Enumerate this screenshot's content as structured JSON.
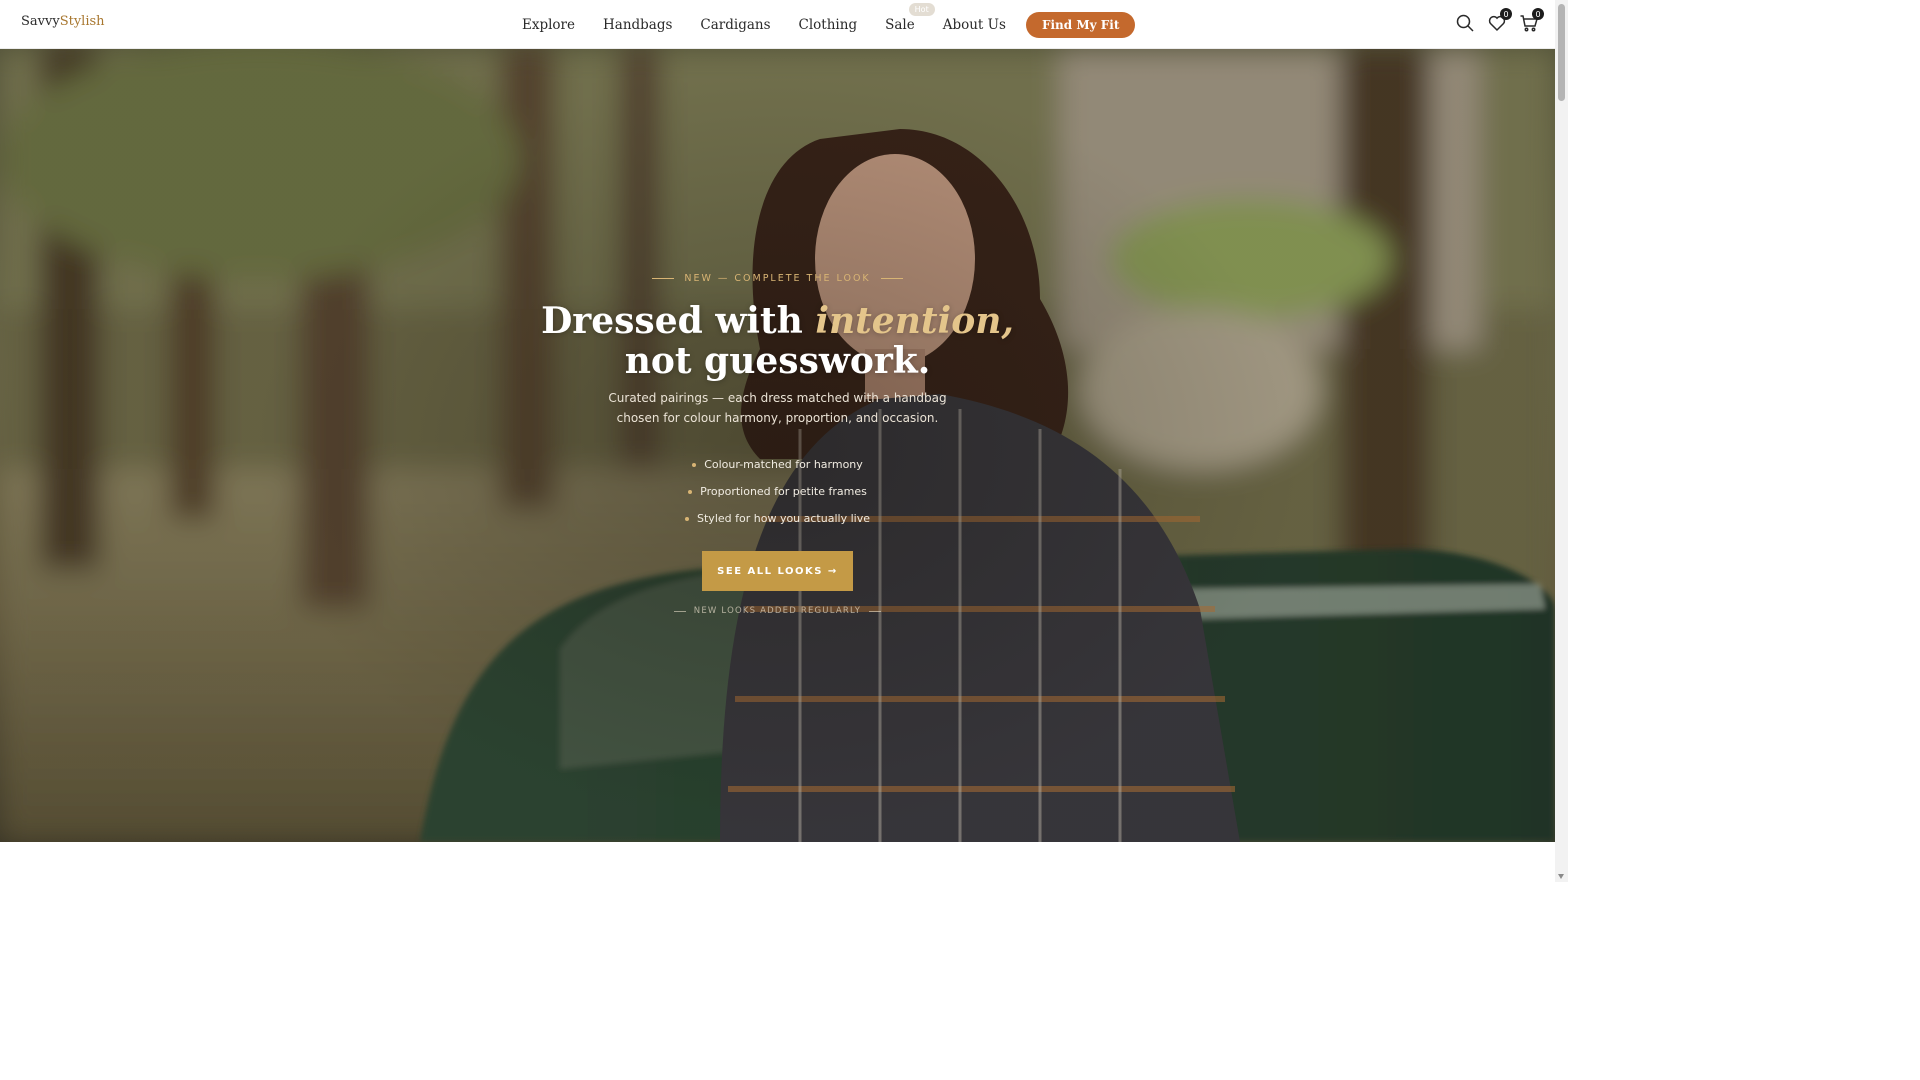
{
  "brand": {
    "name_primary": "Savvy",
    "name_accent": "Stylish",
    "accent_color": "#a8772f"
  },
  "nav": {
    "items": [
      {
        "label": "Explore"
      },
      {
        "label": "Handbags"
      },
      {
        "label": "Cardigans"
      },
      {
        "label": "Clothing"
      },
      {
        "label": "Sale",
        "badge": "Hot"
      },
      {
        "label": "About Us"
      }
    ],
    "cta_label": "Find My Fit",
    "cta_color": "#c4692d"
  },
  "header_icons": {
    "search": {
      "icon": "search-icon"
    },
    "wishlist": {
      "icon": "heart-icon",
      "count": "0"
    },
    "cart": {
      "icon": "cart-icon",
      "count": "0"
    }
  },
  "hero": {
    "eyebrow": "NEW — COMPLETE THE LOOK",
    "headline_part1": "Dressed with ",
    "headline_em": "intention,",
    "headline_line2": "not guesswork.",
    "subtext_line1": "Curated pairings — each dress matched with a handbag",
    "subtext_line2": "chosen for colour harmony, proportion, and occasion.",
    "features": [
      "Colour-matched for harmony",
      "Proportioned for petite frames",
      "Styled for how you actually live"
    ],
    "button_label": "SEE ALL LOOKS →",
    "button_color": "#c49a46",
    "footnote": "NEW LOOKS ADDED REGULARLY"
  }
}
